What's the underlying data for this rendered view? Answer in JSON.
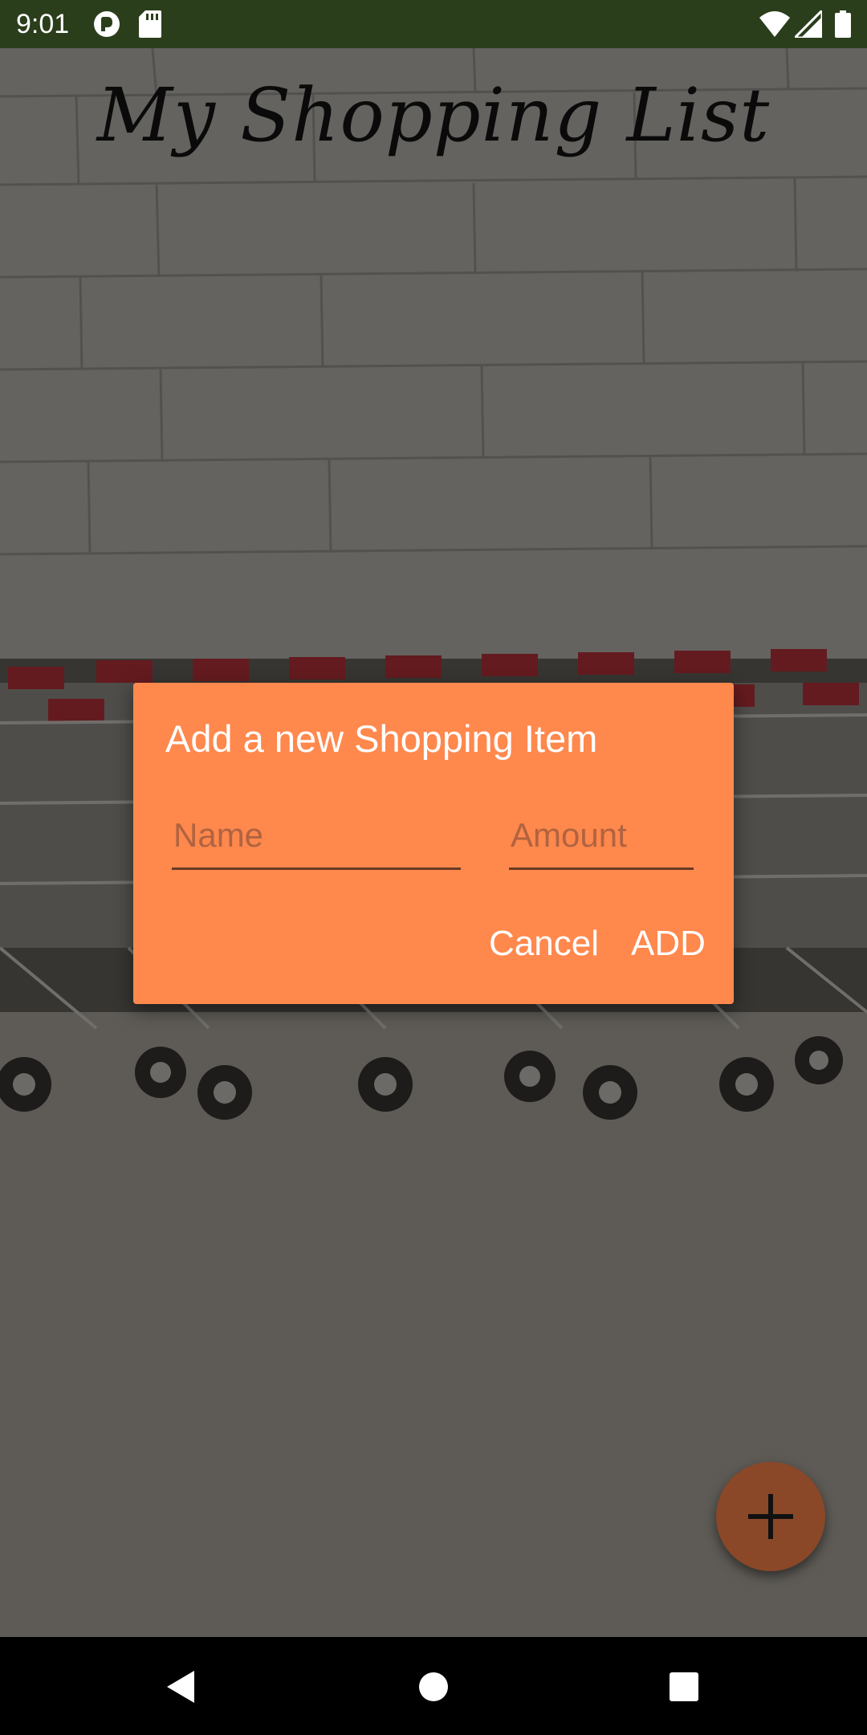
{
  "status_bar": {
    "time": "9:01",
    "icons": [
      "pocket-casts-icon",
      "sd-card-icon",
      "wifi-icon",
      "signal-icon",
      "battery-icon"
    ]
  },
  "app": {
    "title": "My Shopping List"
  },
  "dialog": {
    "title": "Add a new Shopping Item",
    "name_placeholder": "Name",
    "name_value": "",
    "amount_placeholder": "Amount",
    "amount_value": "",
    "cancel_label": "Cancel",
    "add_label": "ADD"
  },
  "fab": {
    "icon": "plus-icon"
  },
  "nav_bar": {
    "icons": [
      "back-icon",
      "home-icon",
      "recents-icon"
    ]
  },
  "colors": {
    "status_bar": "#2b3e1c",
    "dialog_background": "#ff884d",
    "fab": "#8a4828",
    "text_on_dialog": "#ffffff"
  }
}
